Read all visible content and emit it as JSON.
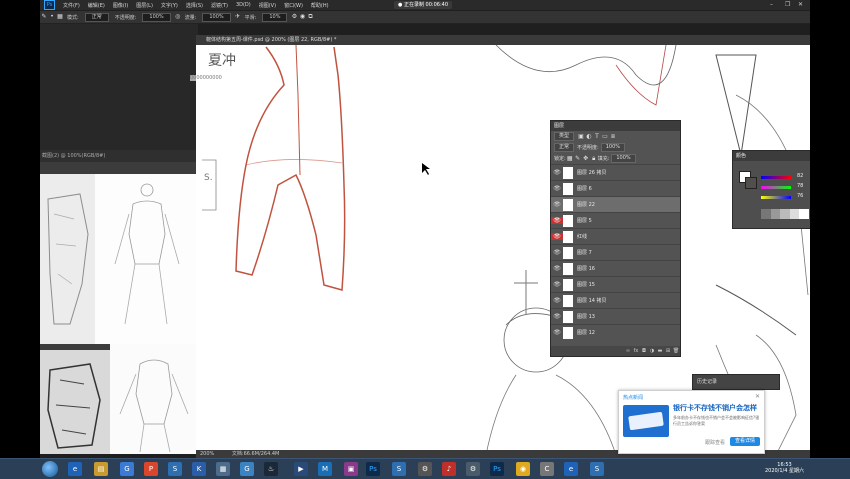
{
  "menubar": {
    "app_icon": "Ps",
    "items": [
      "文件(F)",
      "编辑(E)",
      "图像(I)",
      "图层(L)",
      "文字(Y)",
      "选择(S)",
      "滤镜(T)",
      "3D(D)",
      "视图(V)",
      "窗口(W)",
      "帮助(H)"
    ],
    "timer": "● 正在录制 00:06:40"
  },
  "options": {
    "mode_label": "模式:",
    "mode_value": "正常",
    "opacity_label": "不透明度:",
    "opacity_value": "100%",
    "flow_label": "流量:",
    "flow_value": "100%",
    "smooth_label": "平滑:",
    "smooth_value": "10%"
  },
  "left_panel": {
    "title": "截图(2) @ 100%(RGB/8#)"
  },
  "document": {
    "tab_title": "躯体结构第五周-课件.psd @ 200% (图层 22, RGB/8#) *",
    "zoom_status": "200%",
    "doc_size": "文档:66.6M/264.4M",
    "coords": "0000000000"
  },
  "layers_panel": {
    "title": "图层",
    "filter_label": "类型",
    "blend_mode": "正常",
    "opacity_label": "不透明度:",
    "opacity_value": "100%",
    "lock_label": "锁定:",
    "fill_label": "填充:",
    "fill_value": "100%",
    "rows": [
      {
        "name": "图层 26 拷贝",
        "active": false,
        "red": false
      },
      {
        "name": "图层 6",
        "active": false,
        "red": false
      },
      {
        "name": "图层 22",
        "active": true,
        "red": false
      },
      {
        "name": "图层 5",
        "active": false,
        "red": true
      },
      {
        "name": "红线",
        "active": false,
        "red": true
      },
      {
        "name": "图层 7",
        "active": false,
        "red": false
      },
      {
        "name": "图层 16",
        "active": false,
        "red": false
      },
      {
        "name": "图层 15",
        "active": false,
        "red": false
      },
      {
        "name": "图层 14 拷贝",
        "active": false,
        "red": false
      },
      {
        "name": "图层 13",
        "active": false,
        "red": false
      },
      {
        "name": "图层 12",
        "active": false,
        "red": false
      }
    ]
  },
  "color_panel": {
    "title": "颜色",
    "r": "82",
    "g": "78",
    "b": "76"
  },
  "history_panel": {
    "title": "历史记录"
  },
  "news_popup": {
    "source": "热点新闻",
    "headline": "银行卡不存钱不销户会怎样",
    "body": "多年前办卡不存钱也不销户会不会被影响征信?银行员工告诉你答案",
    "secondary": "跟踪查看",
    "button": "查看详情"
  },
  "taskbar": {
    "time": "16:53",
    "date": "2020/1/4 星期六"
  },
  "colors": {
    "accent": "#31a8ff",
    "layer_red": "#c73333",
    "sketch_red": "#c0533f"
  }
}
